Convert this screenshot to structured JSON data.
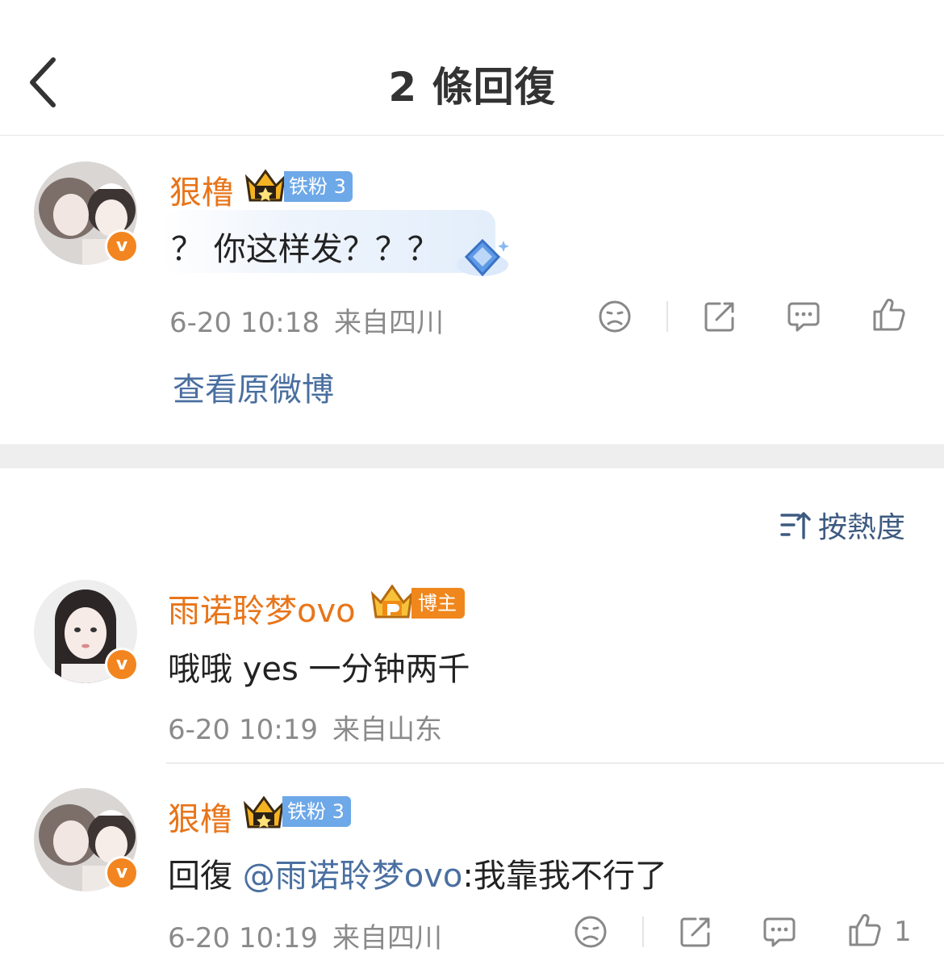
{
  "header": {
    "title": "2 條回復"
  },
  "icons": {
    "back": "back-chevron-icon",
    "dislike": "sad-face-icon",
    "share": "share-icon",
    "comment": "comment-bubble-icon",
    "like": "thumbs-up-icon",
    "sort": "sort-icon",
    "verified": "verified-v-icon",
    "crown": "crown-icon"
  },
  "colors": {
    "username": "#e8751a",
    "link": "#4a6fa0",
    "fan_badge": "#6da8e8",
    "host_badge": "#f0871c",
    "meta": "#8a8a8a"
  },
  "original_comment": {
    "username": "狠橹",
    "fan_badge": "铁粉 3",
    "verified_mark": "v",
    "text": "？ 你这样发？？？",
    "time": "6-20 10:18",
    "location": "来自四川",
    "view_original": "查看原微博"
  },
  "sort": {
    "label": "按熱度"
  },
  "replies": [
    {
      "username": "雨诺聆梦ovo",
      "badge": "博主",
      "verified_mark": "v",
      "text": "哦哦 yes 一分钟两千",
      "time": "6-20 10:19",
      "location": "来自山东"
    },
    {
      "username": "狠橹",
      "fan_badge": "铁粉 3",
      "verified_mark": "v",
      "text_prefix": "回復 ",
      "mention": "@雨诺聆梦ovo",
      "text_suffix": ":我靠我不行了",
      "time": "6-20 10:19",
      "location": "来自四川",
      "like_count": "1"
    }
  ]
}
